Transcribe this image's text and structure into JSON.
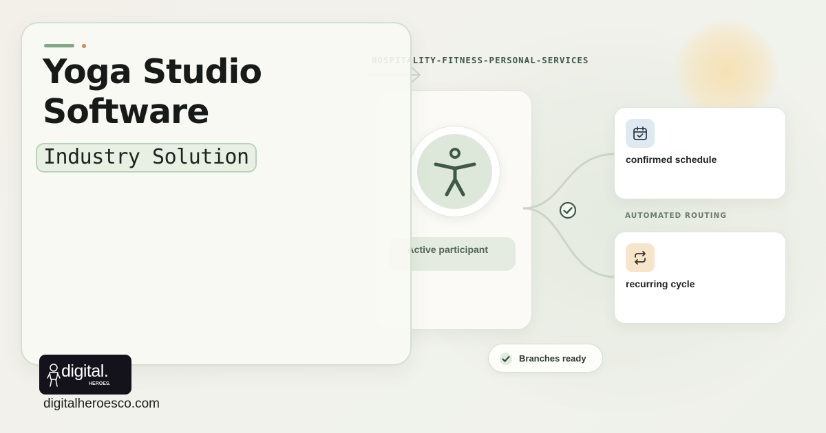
{
  "hero": {
    "title_line1": "Yoga Studio",
    "title_line2": "Software",
    "subtitle": "Industry Solution"
  },
  "brand": {
    "logo_word": "digital.",
    "logo_sub": "HEROES.",
    "website": "digitalheroesco.com"
  },
  "flow": {
    "category": "HOSPITALITY-FITNESS-PERSONAL-SERVICES",
    "hub_label": "Active participant",
    "routing_label": "AUTOMATED ROUTING",
    "nodes": [
      {
        "label": "confirmed schedule",
        "icon": "calendar-check-icon"
      },
      {
        "label": "recurring cycle",
        "icon": "repeat-icon"
      }
    ],
    "status": "Branches ready"
  },
  "colors": {
    "accent_green": "#7fa886",
    "accent_orange": "#cf8d54",
    "dark_green": "#3d5a47",
    "calendar_tile": "#dfe9f1",
    "repeat_tile": "#f6e4cb"
  }
}
